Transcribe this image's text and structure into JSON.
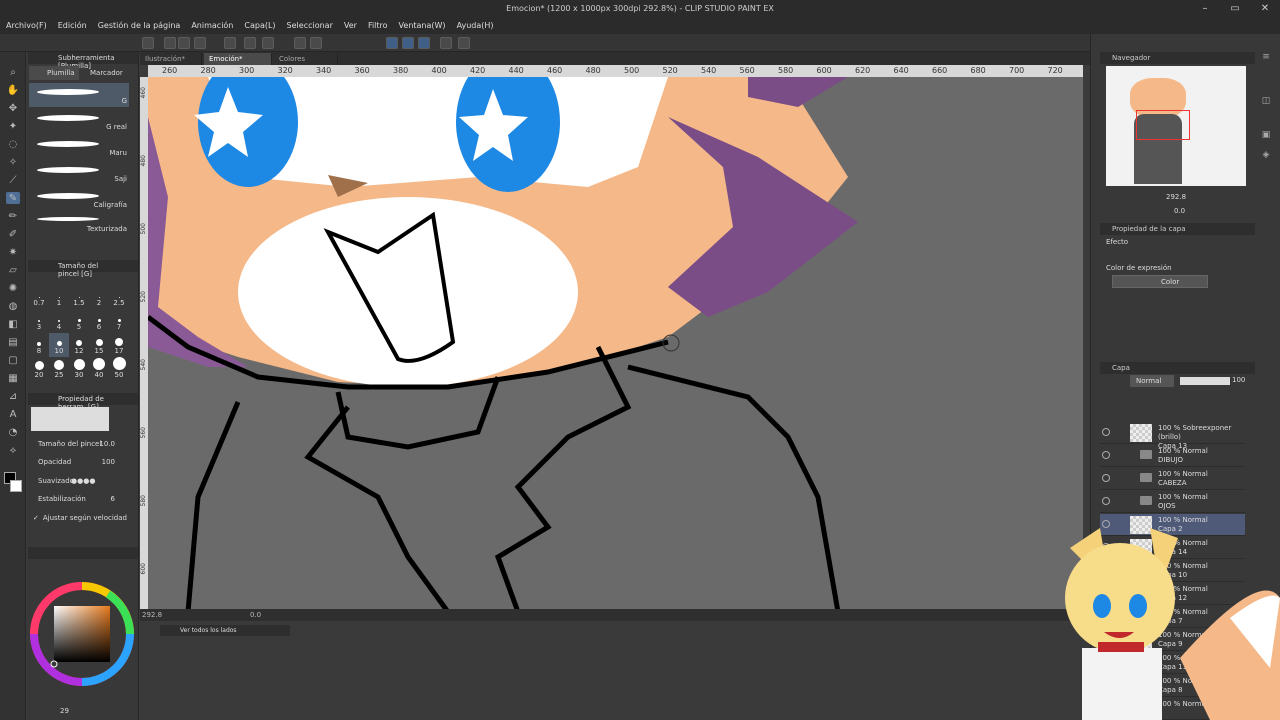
{
  "window": {
    "title": "Emocion* (1200 x 1000px 300dpi 292.8%) - CLIP STUDIO PAINT EX"
  },
  "menu": [
    "Archivo(F)",
    "Edición",
    "Gestión de la página",
    "Animación",
    "Capa(L)",
    "Seleccionar",
    "Ver",
    "Filtro",
    "Ventana(W)",
    "Ayuda(H)"
  ],
  "subtool": {
    "header": "Subherramienta [Plumilla]",
    "tabs": [
      "Plumilla",
      "Marcador"
    ],
    "brushes": [
      "G",
      "G real",
      "Maru",
      "Saji",
      "Caligrafía",
      "Texturizada"
    ]
  },
  "brush_size": {
    "header": "Tamaño del pincel [G]",
    "sizes": [
      "0.7",
      "1",
      "1.5",
      "2",
      "2.5",
      "3",
      "4",
      "5",
      "6",
      "7",
      "8",
      "10",
      "12",
      "15",
      "17",
      "20",
      "25",
      "30",
      "40",
      "50"
    ]
  },
  "tool_property": {
    "header": "Propiedad de herram. [G]",
    "brush_size_label": "Tamaño del pincel",
    "brush_size_value": "10.0",
    "opacity_label": "Opacidad",
    "opacity_value": "100",
    "stabilization_label": "Suavizado",
    "stabilization2_label": "Estabilización",
    "stabilization2_value": "6",
    "speed_label": "Ajustar según velocidad"
  },
  "doc_tabs": [
    "Ilustración*",
    "Emoción*",
    "Colores"
  ],
  "ruler": [
    "260",
    "280",
    "300",
    "320",
    "340",
    "360",
    "380",
    "400",
    "420",
    "440",
    "460",
    "480",
    "500",
    "520",
    "540",
    "560",
    "580",
    "600",
    "620",
    "640",
    "660",
    "680",
    "700",
    "720"
  ],
  "ruler_v": [
    "460",
    "480",
    "500",
    "520",
    "540",
    "560",
    "580",
    "600"
  ],
  "status": {
    "zoom": "292.8",
    "angle": "0.0"
  },
  "bottom": {
    "tab": "Ver todos los lados",
    "frame": "29",
    "a": "0",
    "b": "0"
  },
  "navigator": {
    "title": "Navegador",
    "zoom": "292.8",
    "angle": "0.0"
  },
  "layer_property": {
    "title": "Propiedad de la capa",
    "effect": "Efecto",
    "expression": "Color de expresión",
    "color": "Color"
  },
  "layers": {
    "title": "Capa",
    "blend": "Normal",
    "opacity": "100",
    "rows": [
      {
        "mode": "100 % Sobreexponer (brillo)",
        "name": "Capa 13",
        "folder": false
      },
      {
        "mode": "100 % Normal",
        "name": "DIBUJO",
        "folder": true
      },
      {
        "mode": "100 % Normal",
        "name": "CABEZA",
        "folder": true
      },
      {
        "mode": "100 % Normal",
        "name": "OJOS",
        "folder": true
      },
      {
        "mode": "100 % Normal",
        "name": "Capa 2",
        "folder": false
      },
      {
        "mode": "100 % Normal",
        "name": "Capa 14",
        "folder": false
      },
      {
        "mode": "100 % Normal",
        "name": "Capa 10",
        "folder": false
      },
      {
        "mode": "100 % Normal",
        "name": "Capa 12",
        "folder": false
      },
      {
        "mode": "100 % Normal",
        "name": "Capa 7",
        "folder": false
      },
      {
        "mode": "100 % Normal",
        "name": "Capa 9",
        "folder": false
      },
      {
        "mode": "100 % Normal",
        "name": "Capa 11",
        "folder": false
      },
      {
        "mode": "100 % Normal",
        "name": "Capa 8",
        "folder": false
      },
      {
        "mode": "100 % Normal",
        "name": "",
        "folder": false
      }
    ]
  },
  "colors": {
    "accent": "#4a90d9",
    "skin": "#f5b889",
    "purple": "#7a4d86",
    "eye": "#1e88e5"
  }
}
